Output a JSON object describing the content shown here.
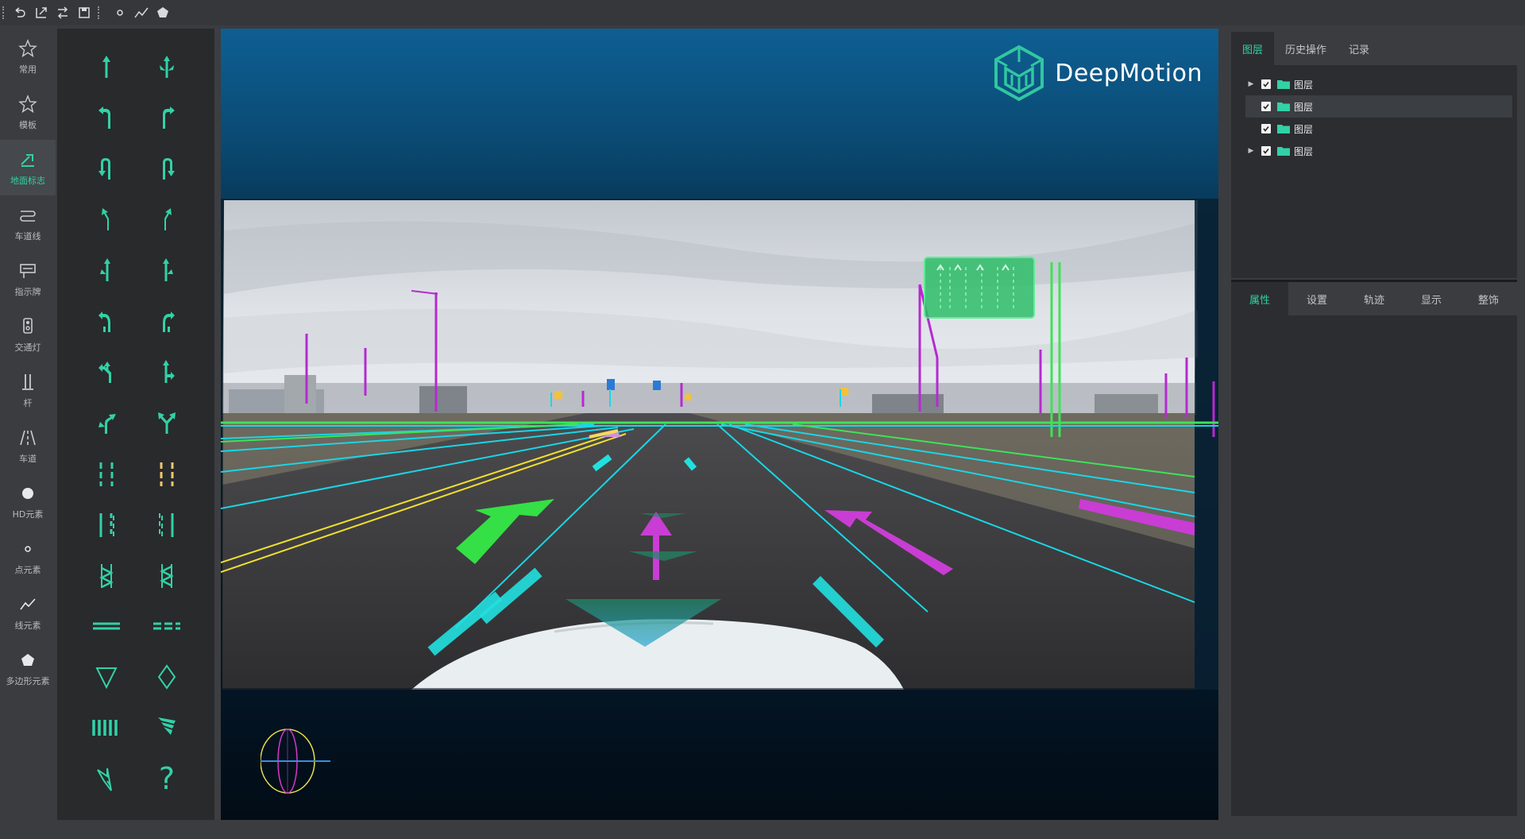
{
  "colors": {
    "accent": "#32d1a6",
    "bg": "#3a3c3f",
    "panel": "#2b2d30",
    "palette": "#282a2c"
  },
  "toolbar": {
    "icons": [
      "undo-icon",
      "export-icon",
      "swap-icon",
      "save-icon",
      "point-icon",
      "polyline-icon",
      "polygon-icon"
    ]
  },
  "nav": {
    "items": [
      {
        "label": "常用",
        "icon": "star-icon"
      },
      {
        "label": "模板",
        "icon": "star-icon"
      },
      {
        "label": "地面标志",
        "icon": "ground-mark-icon",
        "active": true
      },
      {
        "label": "车道线",
        "icon": "lane-line-icon"
      },
      {
        "label": "指示牌",
        "icon": "sign-icon"
      },
      {
        "label": "交通灯",
        "icon": "traffic-light-icon"
      },
      {
        "label": "杆",
        "icon": "pole-icon"
      },
      {
        "label": "车道",
        "icon": "lane-icon"
      },
      {
        "label": "HD元素",
        "icon": "hd-element-icon"
      },
      {
        "label": "点元素",
        "icon": "point-element-icon"
      },
      {
        "label": "线元素",
        "icon": "line-element-icon"
      },
      {
        "label": "多边形元素",
        "icon": "polygon-element-icon"
      }
    ]
  },
  "palette": {
    "items": [
      "straight-arrow-icon",
      "straight-or-right-arrow-icon",
      "left-turn-arrow-icon",
      "right-turn-arrow-icon",
      "left-u-turn-arrow-icon",
      "right-u-turn-arrow-icon",
      "slight-left-arrow-icon",
      "slight-right-arrow-icon",
      "straight-left-arrow-icon",
      "straight-right-arrow-icon",
      "u-turn-left-arrow-icon",
      "u-turn-right-arrow-icon",
      "straight-u-turn-arrow-icon",
      "straight-turn-arrow-icon",
      "left-right-turn-arrow-icon",
      "fork-arrow-icon",
      "dashed-lane-icon",
      "yellow-dashed-lane-icon",
      "striped-lane-icon",
      "double-striped-lane-icon",
      "zigzag-mark-icon",
      "zigzag-mark-alt-icon",
      "stop-line-icon",
      "dashed-stop-line-icon",
      "yield-triangle-icon",
      "diamond-mark-icon",
      "crosswalk-icon",
      "deceleration-mark-icon",
      "guide-arrow-mark-icon",
      "unknown-mark-icon"
    ],
    "unknown_glyph": "?"
  },
  "viewer": {
    "logo_text": "DeepMotion"
  },
  "layers_panel": {
    "tabs": [
      {
        "label": "图层",
        "active": true
      },
      {
        "label": "历史操作"
      },
      {
        "label": "记录"
      }
    ],
    "rows": [
      {
        "label": "图层",
        "expandable": true,
        "checked": true,
        "selected": false
      },
      {
        "label": "图层",
        "expandable": false,
        "checked": true,
        "selected": true
      },
      {
        "label": "图层",
        "expandable": false,
        "checked": true,
        "selected": false
      },
      {
        "label": "图层",
        "expandable": true,
        "checked": true,
        "selected": false
      }
    ]
  },
  "props_panel": {
    "tabs": [
      {
        "label": "属性",
        "active": true
      },
      {
        "label": "设置"
      },
      {
        "label": "轨迹"
      },
      {
        "label": "显示"
      },
      {
        "label": "整饰"
      }
    ]
  }
}
